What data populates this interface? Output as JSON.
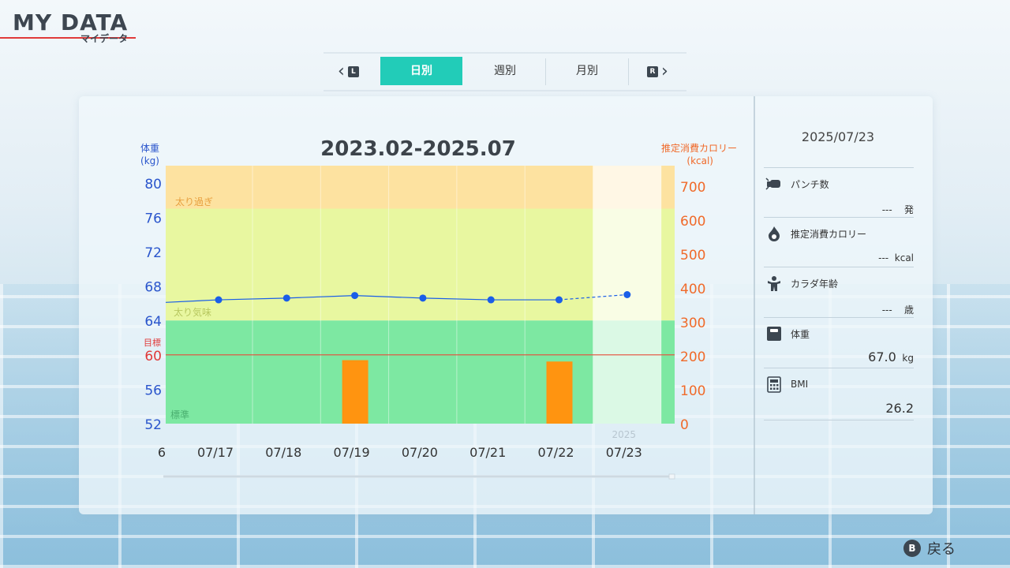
{
  "header": {
    "title_en": "MY DATA",
    "title_jp": "マイデータ"
  },
  "tabs": [
    {
      "label": "日別",
      "active": true
    },
    {
      "label": "週別",
      "active": false
    },
    {
      "label": "月別",
      "active": false
    }
  ],
  "nav": {
    "prev_key": "L",
    "next_key": "R"
  },
  "chart": {
    "title": "2023.02-2025.07",
    "left_axis_label": "体重",
    "left_axis_unit": "(kg)",
    "right_axis_label": "推定消費カロリー",
    "right_axis_unit": "(kcal)",
    "target_label": "目標",
    "zone_labels": {
      "overweight": "太り過ぎ",
      "slightly_over": "太り気味",
      "standard": "標準"
    },
    "year_label": "2025"
  },
  "chart_data": {
    "type": "bar+line",
    "categories": [
      "07/17",
      "07/18",
      "07/19",
      "07/20",
      "07/21",
      "07/22",
      "07/23"
    ],
    "partial_left_label": "6",
    "weight_kg": [
      66.4,
      66.6,
      66.9,
      66.6,
      66.4,
      66.4,
      67.0
    ],
    "weight_prev_edge": 66.1,
    "calories_kcal": [
      0,
      0,
      187,
      0,
      0,
      183,
      0
    ],
    "target_weight": 60,
    "left_axis": {
      "ticks": [
        52,
        56,
        60,
        64,
        68,
        72,
        76,
        80
      ],
      "range": [
        52,
        82
      ]
    },
    "right_axis": {
      "ticks": [
        0,
        100,
        200,
        300,
        400,
        500,
        600,
        700
      ],
      "range": [
        0,
        760
      ]
    },
    "zones": [
      {
        "name": "standard",
        "from": 52,
        "to": 64,
        "color": "#7de8a2"
      },
      {
        "name": "slightly_over",
        "from": 64,
        "to": 77,
        "color": "#e8f7a0"
      },
      {
        "name": "overweight",
        "from": 77,
        "to": 82,
        "color": "#fde2a0"
      }
    ],
    "colors": {
      "weight_line": "#1a5ee8",
      "calorie_bar": "#ff9410",
      "target_line": "#e84a3a",
      "left_axis": "#2a55cc",
      "right_axis": "#f06a2a"
    }
  },
  "side": {
    "date": "2025/07/23",
    "items": [
      {
        "label": "パンチ数",
        "value": "---",
        "unit": "発",
        "icon": "punch-icon"
      },
      {
        "label": "推定消費カロリー",
        "value": "---",
        "unit": "kcal",
        "icon": "flame-icon"
      },
      {
        "label": "カラダ年齢",
        "value": "---",
        "unit": "歳",
        "icon": "body-age-icon"
      },
      {
        "label": "体重",
        "value": "67.0",
        "unit": "kg",
        "icon": "scale-icon"
      },
      {
        "label": "BMI",
        "value": "26.2",
        "unit": "",
        "icon": "calculator-icon"
      }
    ]
  },
  "footer": {
    "back_key": "B",
    "back_label": "戻る"
  }
}
